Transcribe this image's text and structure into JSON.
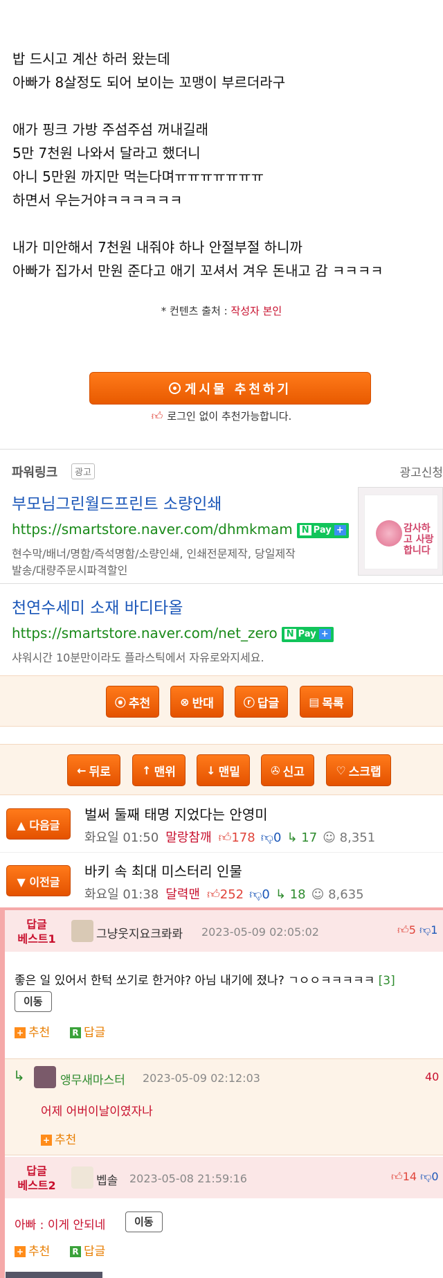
{
  "article": {
    "lines": [
      "밥 드시고 계산 하러 왔는데",
      "아빠가 8살정도 되어 보이는 꼬맹이 부르더라구",
      "",
      "애가 핑크 가방 주섬주섬 꺼내길래",
      "5만 7천원 나와서 달라고 했더니",
      "아니 5만원 까지만 먹는다며ㅠㅠㅠㅠㅠㅠㅠ",
      "하면서 우는거야ㅋㅋㅋㅋㅋㅋ",
      "",
      "내가 미안해서 7천원 내줘야 하나 안절부절 하니까",
      "아빠가 집가서 만원 준다고 애기 꼬셔서 겨우 돈내고 감 ㅋㅋㅋㅋ"
    ],
    "source_label": "* 컨텐츠 출처 : ",
    "source_value": "작성자 본인"
  },
  "recommend": {
    "button_label": "게시물 추천하기",
    "login_note": "로그인 없이 추천가능합니다."
  },
  "powerlink": {
    "title": "파워링크",
    "badge": "광고",
    "apply": "광고신청",
    "ads": [
      {
        "title": "부모님그린월드프린트 소량인쇄",
        "url": "https://smartstore.naver.com/dhmkmam",
        "desc1": "현수막/배너/명함/즉석명함/소량인쇄, 인쇄전문제작, 당일제작",
        "desc2": "발송/대량주문시파격할인",
        "pay": "Pay",
        "image_text": "감사하고 사랑합니다"
      },
      {
        "title": "천연수세미 소재 바디타올",
        "url": "https://smartstore.naver.com/net_zero",
        "desc1": "샤워시간 10분만이라도 플라스틱에서 자유로와지세요.",
        "pay": "Pay"
      }
    ]
  },
  "vote_bar": {
    "buttons": [
      {
        "icon": "⦿",
        "label": "추천"
      },
      {
        "icon": "⊗",
        "label": "반대"
      },
      {
        "icon": "ⓡ",
        "label": "답글"
      },
      {
        "icon": "▤",
        "label": "목록"
      }
    ]
  },
  "nav_bar": {
    "buttons": [
      {
        "icon": "←",
        "label": "뒤로"
      },
      {
        "icon": "↑",
        "label": "맨위"
      },
      {
        "icon": "↓",
        "label": "맨밑"
      },
      {
        "icon": "✇",
        "label": "신고"
      },
      {
        "icon": "♡",
        "label": "스크랩"
      }
    ]
  },
  "adjacent": [
    {
      "button": "▲ 다음글",
      "title": "벌써 둘째 태명 지었다는 안영미",
      "time": "화요일 01:50",
      "nick": "말랑참깨",
      "up": "178",
      "down": "0",
      "replies": "17",
      "views": "8,351"
    },
    {
      "button": "▼ 이전글",
      "title": "바키 속 최대 미스터리 인물",
      "time": "화요일 01:38",
      "nick": "달력맨",
      "up": "252",
      "down": "0",
      "replies": "18",
      "views": "8,635"
    }
  ],
  "comments": {
    "best1": {
      "label_line1": "답글",
      "label_line2": "베스트1",
      "nick": "그냥웃지요크롸롸",
      "date": "2023-05-09 02:05:02",
      "up": "5",
      "down": "1",
      "text": "좋은 일 있어서 한턱 쏘기로 한거야? 아님 내기에 졌나? ㄱㅇㅇㅋㅋㅋㅋㅋ",
      "reply_count": "[3]",
      "move": "이동",
      "recommend": "추천",
      "reply": "답글"
    },
    "reply1": {
      "nick": "앵무새마스터",
      "date": "2023-05-09 02:12:03",
      "votes": "40",
      "text": "어제 어버이날이였자나",
      "recommend": "추천"
    },
    "best2": {
      "label_line1": "답글",
      "label_line2": "베스트2",
      "nick": "벱솔",
      "date": "2023-05-08 21:59:16",
      "up": "14",
      "down": "0",
      "text": "아빠 : 이게 안되네",
      "move": "이동",
      "recommend": "추천",
      "reply": "답글"
    }
  },
  "colors": {
    "accent_orange": "#ff7a1a",
    "nick_red": "#c8102e",
    "link_blue": "#1a56b8",
    "url_green": "#1a8a1a"
  }
}
